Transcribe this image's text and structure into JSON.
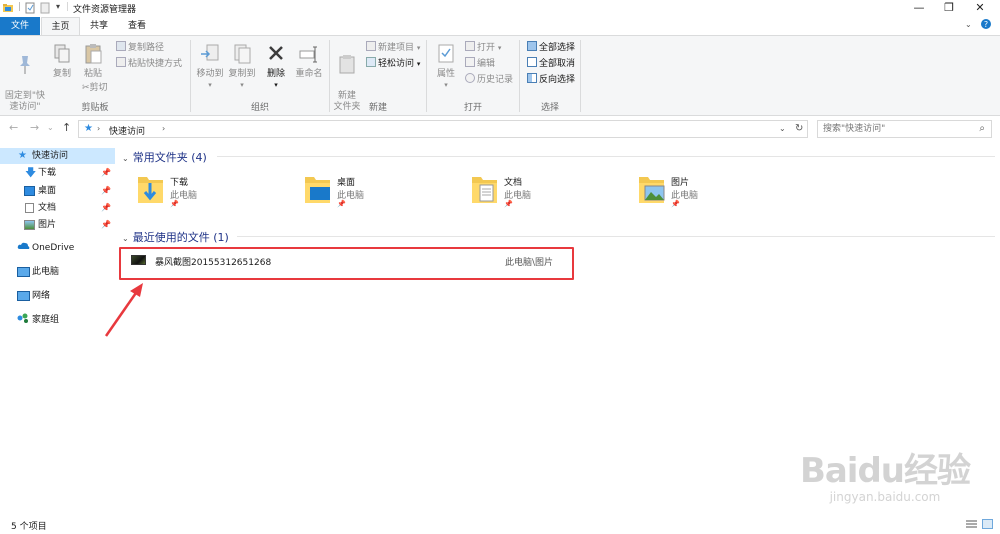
{
  "window": {
    "title": "文件资源管理器",
    "controls": [
      "minimize",
      "maximize",
      "close"
    ]
  },
  "ribbon": {
    "tabs": [
      "文件",
      "主页",
      "共享",
      "查看"
    ],
    "active_tab": "主页",
    "groups": {
      "clipboard": {
        "label": "剪贴板",
        "pin_quick_access": "固定到\"快\n速访问\"",
        "copy": "复制",
        "paste": "粘贴",
        "copy_path": "复制路径",
        "paste_shortcut": "粘贴快捷方式",
        "cut": "剪切"
      },
      "organize": {
        "label": "组织",
        "move_to": "移动到",
        "copy_to": "复制到",
        "delete": "删除",
        "rename": "重命名"
      },
      "new": {
        "label": "新建",
        "new_folder": "新建\n文件夹",
        "new_item": "新建项目",
        "easy_access": "轻松访问"
      },
      "open": {
        "label": "打开",
        "properties": "属性",
        "open": "打开",
        "edit": "编辑",
        "history": "历史记录"
      },
      "select": {
        "label": "选择",
        "select_all": "全部选择",
        "select_none": "全部取消",
        "invert": "反向选择"
      }
    }
  },
  "address": {
    "path": "快速访问",
    "search_placeholder": "搜索\"快速访问\""
  },
  "nav": {
    "quick_access": "快速访问",
    "items": [
      {
        "label": "下载",
        "pinned": true
      },
      {
        "label": "桌面",
        "pinned": true
      },
      {
        "label": "文档",
        "pinned": true
      },
      {
        "label": "图片",
        "pinned": true
      }
    ],
    "onedrive": "OneDrive",
    "this_pc": "此电脑",
    "network": "网络",
    "homegroup": "家庭组"
  },
  "content": {
    "frequent_header": "常用文件夹 (4)",
    "folders": [
      {
        "name": "下载",
        "location": "此电脑"
      },
      {
        "name": "桌面",
        "location": "此电脑"
      },
      {
        "name": "文档",
        "location": "此电脑"
      },
      {
        "name": "图片",
        "location": "此电脑"
      }
    ],
    "recent_header": "最近使用的文件 (1)",
    "recent_files": [
      {
        "name": "暴风截图20155312651268",
        "path": "此电脑\\图片"
      }
    ]
  },
  "status": {
    "item_count": "5 个项目"
  },
  "watermark": {
    "brand": "Baidu经验",
    "url": "jingyan.baidu.com"
  },
  "colors": {
    "accent": "#1979ca",
    "highlight_box": "#e8393e",
    "section_header": "#1e3287",
    "selected_nav": "#cce8ff"
  }
}
